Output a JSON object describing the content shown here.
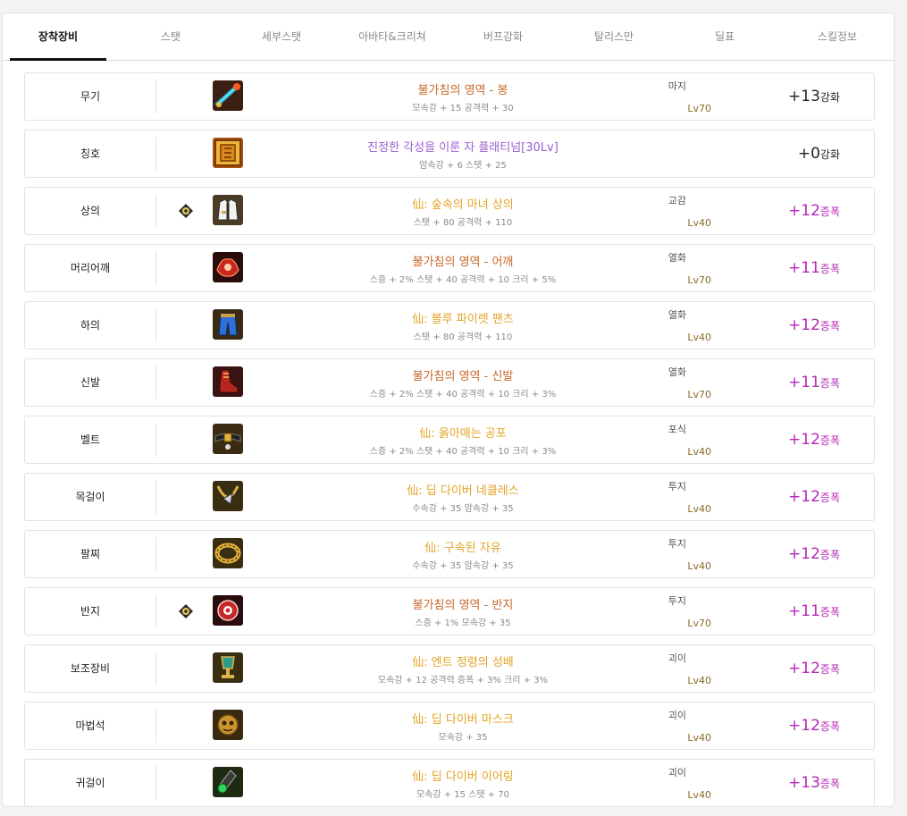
{
  "tabs": [
    {
      "label": "장착장비",
      "active": true
    },
    {
      "label": "스탯",
      "active": false
    },
    {
      "label": "세부스탯",
      "active": false
    },
    {
      "label": "아바타&크리쳐",
      "active": false
    },
    {
      "label": "버프강화",
      "active": false
    },
    {
      "label": "탈리스만",
      "active": false
    },
    {
      "label": "딜표",
      "active": false
    },
    {
      "label": "스킬정보",
      "active": false
    }
  ],
  "colors": {
    "epic_name": "#c8682a",
    "legendary_name": "#e5a327",
    "title_name": "#9a5fd0",
    "amplify": "#b529b5",
    "enhance": "#222222",
    "level": "#8b6a2a"
  },
  "equipment": [
    {
      "slot": "무기",
      "marker": false,
      "icon": "staff-weapon-icon",
      "name": "불가침의 영역 - 봉",
      "rarity": "epic",
      "stats": "모속강 + 15 공격력 + 30",
      "enchant": "마지",
      "level": "Lv70",
      "refine_value": "+13",
      "refine_type": "강화",
      "refine_kind": "enhance"
    },
    {
      "slot": "칭호",
      "marker": false,
      "icon": "title-scroll-icon",
      "name": "진정한 각성을 이룬 자 플래티넘[30Lv]",
      "rarity": "title",
      "stats": "암속강 + 6 스탯 + 25",
      "enchant": "",
      "level": "",
      "refine_value": "+0",
      "refine_type": "강화",
      "refine_kind": "enhance"
    },
    {
      "slot": "상의",
      "marker": true,
      "icon": "coat-armor-icon",
      "name": "仙: 숲속의 마녀 상의",
      "rarity": "legendary",
      "stats": "스탯 + 80 공격력 + 110",
      "enchant": "교감",
      "level": "Lv40",
      "refine_value": "+12",
      "refine_type": "증폭",
      "refine_kind": "amplify"
    },
    {
      "slot": "머리어깨",
      "marker": false,
      "icon": "shoulder-armor-icon",
      "name": "불가침의 영역 - 어깨",
      "rarity": "epic",
      "stats": "스증 + 2% 스탯 + 40 공격력 + 10 크리 + 5%",
      "enchant": "열화",
      "level": "Lv70",
      "refine_value": "+11",
      "refine_type": "증폭",
      "refine_kind": "amplify"
    },
    {
      "slot": "하의",
      "marker": false,
      "icon": "pants-armor-icon",
      "name": "仙: 블루 파이렛 팬츠",
      "rarity": "legendary",
      "stats": "스탯 + 80 공격력 + 110",
      "enchant": "열화",
      "level": "Lv40",
      "refine_value": "+12",
      "refine_type": "증폭",
      "refine_kind": "amplify"
    },
    {
      "slot": "신발",
      "marker": false,
      "icon": "shoes-armor-icon",
      "name": "불가침의 영역 - 신발",
      "rarity": "epic",
      "stats": "스증 + 2% 스탯 + 40 공격력 + 10 크리 + 3%",
      "enchant": "열화",
      "level": "Lv70",
      "refine_value": "+11",
      "refine_type": "증폭",
      "refine_kind": "amplify"
    },
    {
      "slot": "벨트",
      "marker": false,
      "icon": "belt-armor-icon",
      "name": "仙: 옭아매는 공포",
      "rarity": "legendary",
      "stats": "스증 + 2% 스탯 + 40 공격력 + 10 크리 + 3%",
      "enchant": "포식",
      "level": "Lv40",
      "refine_value": "+12",
      "refine_type": "증폭",
      "refine_kind": "amplify"
    },
    {
      "slot": "목걸이",
      "marker": false,
      "icon": "necklace-accessory-icon",
      "name": "仙: 딥 다이버 네클레스",
      "rarity": "legendary",
      "stats": "수속강 + 35 암속강 + 35",
      "enchant": "투지",
      "level": "Lv40",
      "refine_value": "+12",
      "refine_type": "증폭",
      "refine_kind": "amplify"
    },
    {
      "slot": "팔찌",
      "marker": false,
      "icon": "bracelet-accessory-icon",
      "name": "仙: 구속된 자유",
      "rarity": "legendary",
      "stats": "수속강 + 35 암속강 + 35",
      "enchant": "투지",
      "level": "Lv40",
      "refine_value": "+12",
      "refine_type": "증폭",
      "refine_kind": "amplify"
    },
    {
      "slot": "반지",
      "marker": true,
      "icon": "ring-accessory-icon",
      "name": "불가침의 영역 - 반지",
      "rarity": "epic",
      "stats": "스증 + 1% 모속강 + 35",
      "enchant": "투지",
      "level": "Lv70",
      "refine_value": "+11",
      "refine_type": "증폭",
      "refine_kind": "amplify"
    },
    {
      "slot": "보조장비",
      "marker": false,
      "icon": "sub-equipment-icon",
      "name": "仙: 엔트 정령의 성배",
      "rarity": "legendary",
      "stats": "모속강 + 12 공격력 증폭 + 3% 크리 + 3%",
      "enchant": "괴이",
      "level": "Lv40",
      "refine_value": "+12",
      "refine_type": "증폭",
      "refine_kind": "amplify"
    },
    {
      "slot": "마법석",
      "marker": false,
      "icon": "magic-stone-icon",
      "name": "仙: 딥 다이버 마스크",
      "rarity": "legendary",
      "stats": "모속강 + 35",
      "enchant": "괴이",
      "level": "Lv40",
      "refine_value": "+12",
      "refine_type": "증폭",
      "refine_kind": "amplify"
    },
    {
      "slot": "귀걸이",
      "marker": false,
      "icon": "earring-icon",
      "name": "仙: 딥 다이버 이어링",
      "rarity": "legendary",
      "stats": "모속강 + 15 스탯 + 70",
      "enchant": "괴이",
      "level": "Lv40",
      "refine_value": "+13",
      "refine_type": "증폭",
      "refine_kind": "amplify"
    }
  ]
}
